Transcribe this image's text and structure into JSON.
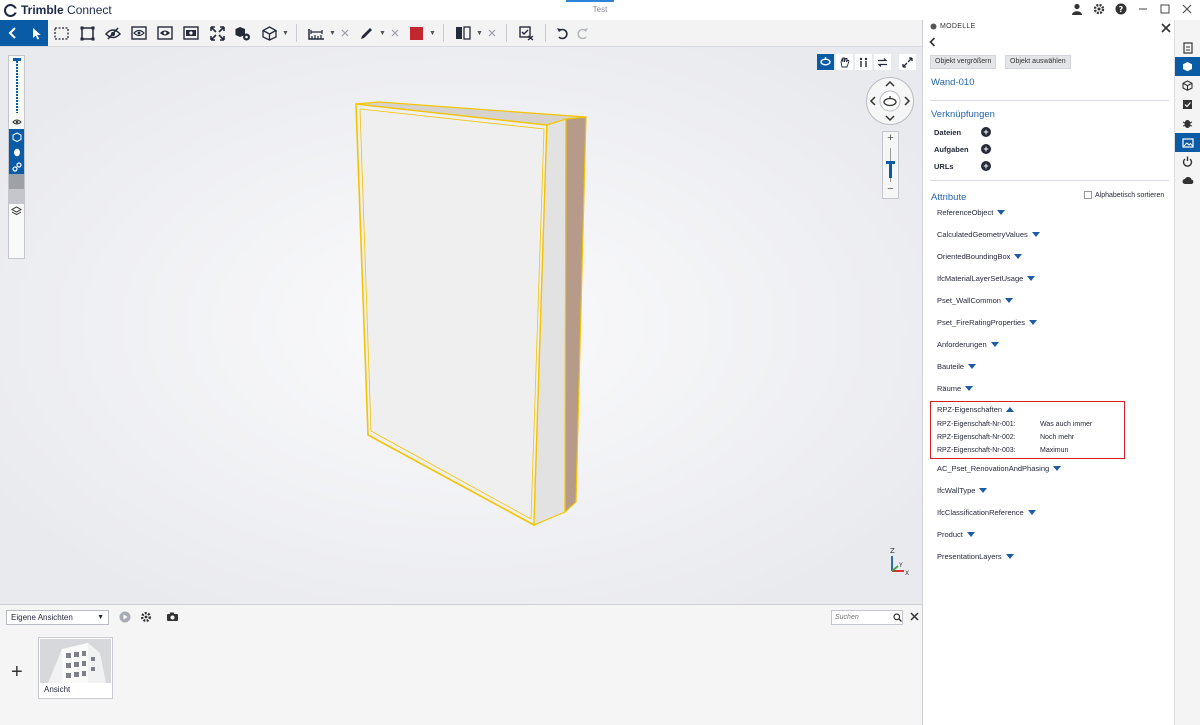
{
  "app": {
    "brand_bold": "Trimble",
    "brand_light": " Connect",
    "document_title": "Test"
  },
  "toolbar": {
    "tools": [
      "back",
      "select",
      "box-select",
      "isolate",
      "hide",
      "visibility",
      "ghost",
      "sections",
      "fit",
      "model-tree",
      "view-3d",
      "measure",
      "markup",
      "color",
      "clip",
      "clear",
      "undo",
      "redo"
    ],
    "markup_color": "#c1272d"
  },
  "viewport": {
    "axis_labels": {
      "z": "Z",
      "y": "Y",
      "x": "X"
    },
    "zoom_plus": "+",
    "zoom_minus": "−"
  },
  "bottom": {
    "views_dropdown": "Eigene Ansichten",
    "search_placeholder": "Suchen",
    "add_label": "+",
    "thumbnail_label": "Ansicht"
  },
  "panel": {
    "header": "MODELLE",
    "buttons": {
      "zoom_object": "Objekt vergrößern",
      "select_object": "Objekt auswählen"
    },
    "object_name": "Wand-010",
    "links_title": "Verknüpfungen",
    "links": [
      "Dateien",
      "Aufgaben",
      "URLs"
    ],
    "attributes_title": "Attribute",
    "sort_label": "Alphabetisch sortieren",
    "attributes_before": [
      "ReferenceObject",
      "CalculatedGeometryValues",
      "OrientedBoundingBox",
      "IfcMaterialLayerSetUsage",
      "Pset_WallCommon",
      "Pset_FireRatingProperties",
      "Anforderungen",
      "Bauteile",
      "Räume"
    ],
    "expanded_group": {
      "name": "RPZ-Eigenschaften",
      "properties": [
        {
          "key": "RPZ-Eigenschaft-Nr-001:",
          "value": "Was auch immer"
        },
        {
          "key": "RPZ-Eigenschaft-Nr-002:",
          "value": "Noch mehr"
        },
        {
          "key": "RPZ-Eigenschaft-Nr-003:",
          "value": "Maximun"
        }
      ]
    },
    "attributes_after": [
      "AC_Pset_RenovationAndPhasing",
      "IfcWallType",
      "IfcClassificationReference",
      "Product",
      "PresentationLayers"
    ]
  },
  "colors": {
    "accent": "#0a5ba6",
    "link_blue": "#2565b0",
    "highlight_red": "#d32020",
    "selection_yellow": "#f5c400"
  }
}
